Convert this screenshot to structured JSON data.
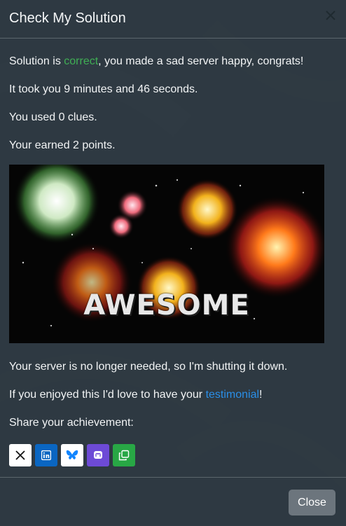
{
  "modal": {
    "title": "Check My Solution",
    "line1": {
      "before": "Solution is ",
      "status": "correct",
      "after": ", you made a sad server happy, congrats!"
    },
    "time_text": "It took you 9 minutes and 46 seconds.",
    "clues_text": "You used 0 clues.",
    "points_text": "Your earned 2 points.",
    "gif_text": "AWESOME",
    "shutdown_text": "Your server is no longer needed, so I'm shutting it down.",
    "testimonial": {
      "before": "If you enjoyed this I'd love to have your ",
      "link": "testimonial",
      "after": "!"
    },
    "share_label": "Share your achievement:",
    "share_buttons": [
      {
        "name": "x-icon",
        "bg": "#ffffff"
      },
      {
        "name": "linkedin-icon",
        "bg": "#0a66c2"
      },
      {
        "name": "bluesky-icon",
        "bg": "#ffffff"
      },
      {
        "name": "mastodon-icon",
        "bg": "#6d4ad6"
      },
      {
        "name": "copy-icon",
        "bg": "#28a745"
      }
    ],
    "close_label": "Close"
  },
  "colors": {
    "correct": "#3fae54",
    "link": "#2a8fe8",
    "close_button": "#6c757d"
  }
}
